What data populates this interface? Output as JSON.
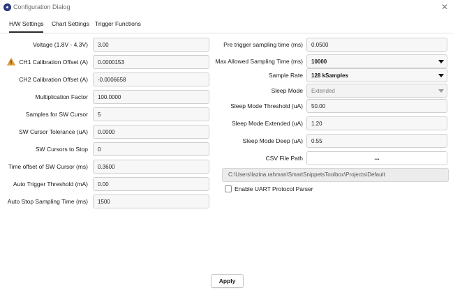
{
  "window": {
    "title": "Configuration Dialog",
    "close_glyph": "✕"
  },
  "tabs": [
    {
      "label": "H/W Settings",
      "active": true
    },
    {
      "label": "Chart Settings",
      "active": false
    },
    {
      "label": "Trigger Functions",
      "active": false
    }
  ],
  "left_fields": [
    {
      "label": "Voltage (1.8V - 4.3V)",
      "value": "3.00"
    },
    {
      "label": "CH1 Calibration Offset (A)",
      "value": "0.0000153",
      "warning": true
    },
    {
      "label": "CH2 Calibration Offset (A)",
      "value": "-0.0006658"
    },
    {
      "label": "Multiplication Factor",
      "value": "100.0000"
    },
    {
      "label": "Samples for SW Cursor",
      "value": "5"
    },
    {
      "label": "SW Cursor Tolerance (uA)",
      "value": "0.0000"
    },
    {
      "label": "SW Cursors to Stop",
      "value": "0"
    },
    {
      "label": "Time offset of SW Cursor (ms)",
      "value": "0.3600"
    },
    {
      "label": "Auto Trigger Threshold (mA)",
      "value": "0.00"
    },
    {
      "label": "Auto Stop Sampling Time (ms)",
      "value": "1500"
    }
  ],
  "right_fields": {
    "pre_trigger": {
      "label": "Pre trigger sampling time (ms)",
      "value": "0.0500"
    },
    "max_sampling": {
      "label": "Max Allowed Sampling Time (ms)",
      "value": "10000"
    },
    "sample_rate": {
      "label": "Sample Rate",
      "value": "128 kSamples"
    },
    "sleep_mode": {
      "label": "Sleep Mode",
      "value": "Extended",
      "disabled": true
    },
    "sleep_threshold": {
      "label": "Sleep Mode Threshold (uA)",
      "value": "50.00"
    },
    "sleep_extended": {
      "label": "Sleep Mode Extended (uA)",
      "value": "1.20"
    },
    "sleep_deep": {
      "label": "Sleep Mode Deep (uA)",
      "value": "0.55"
    },
    "csv_path": {
      "label": "CSV File Path",
      "browse_label": "...",
      "path": "C:\\Users\\lazina.rahman\\SmartSnippetsToolbox\\Projects\\Default"
    }
  },
  "uart": {
    "label": "Enable UART Protocol Parser",
    "checked": false
  },
  "apply_label": "Apply",
  "icons": {
    "app": "app-logo-icon",
    "warning": "warning-icon",
    "warning_color": "#e8a33a",
    "dropdown": "chevron-down-icon"
  }
}
